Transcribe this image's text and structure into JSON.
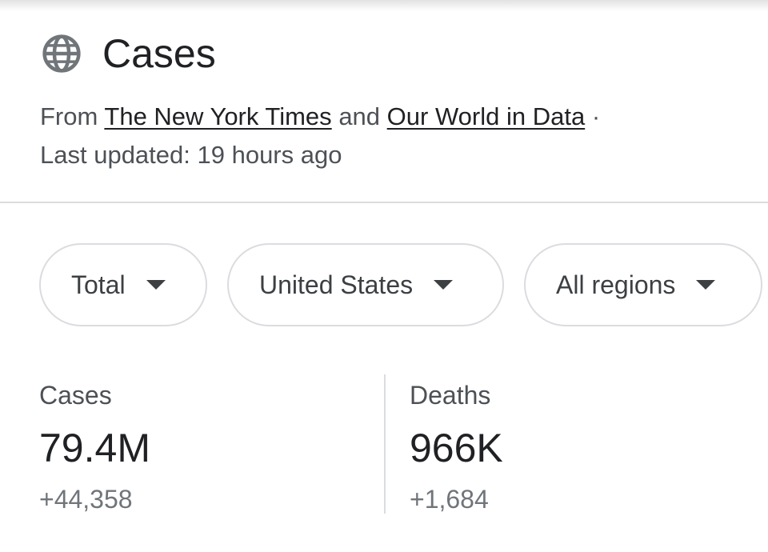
{
  "header": {
    "icon": "globe-icon",
    "title": "Cases"
  },
  "source": {
    "prefix": "From",
    "link1": "The New York Times",
    "and": "and",
    "link2": "Our World in Data",
    "separator": "·",
    "updated": "Last updated: 19 hours ago"
  },
  "filters": [
    {
      "label": "Total"
    },
    {
      "label": "United States"
    },
    {
      "label": "All regions"
    }
  ],
  "stats": [
    {
      "label": "Cases",
      "value": "79.4M",
      "change": "+44,358"
    },
    {
      "label": "Deaths",
      "value": "966K",
      "change": "+1,684"
    }
  ],
  "colors": {
    "text_primary": "#202124",
    "text_secondary": "#4d5156",
    "border": "#dadce0"
  }
}
